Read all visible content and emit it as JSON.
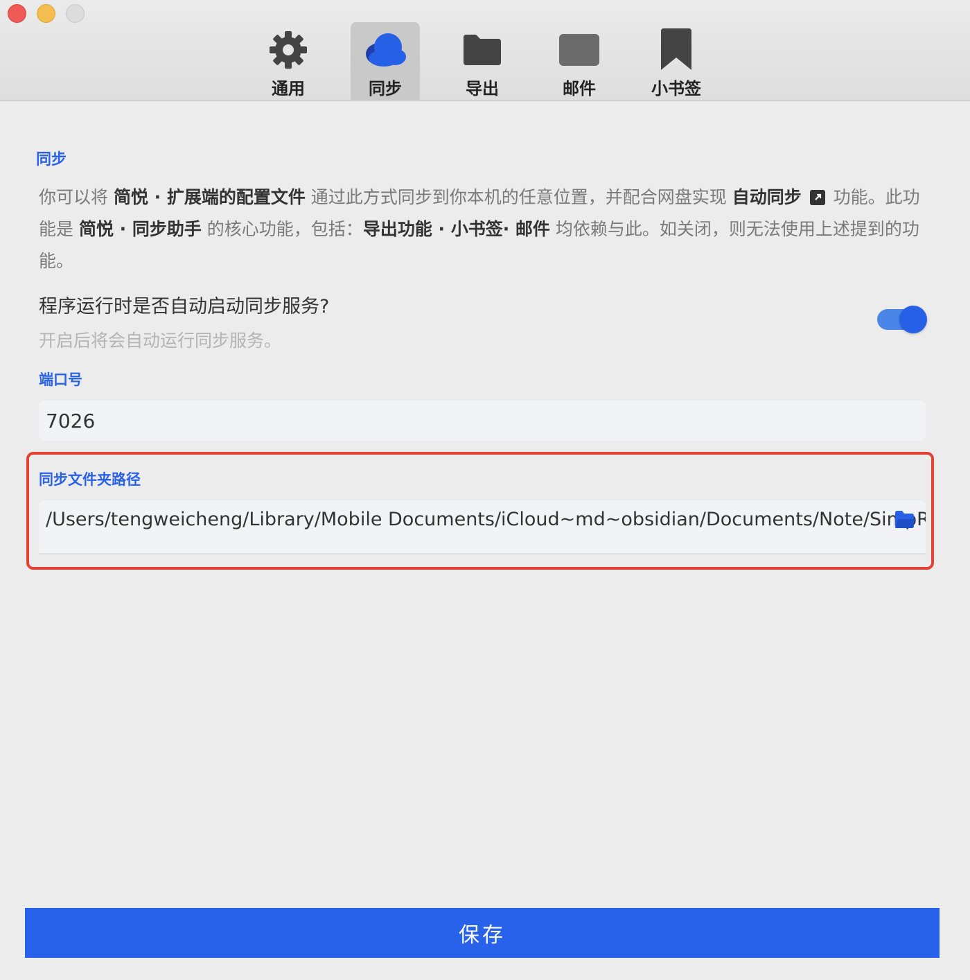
{
  "window": {
    "traffic_lights": [
      "close",
      "minimize",
      "maximize"
    ]
  },
  "tabs": [
    {
      "label": "通用",
      "icon": "gear-icon",
      "active": false
    },
    {
      "label": "同步",
      "icon": "cloud-icon",
      "active": true
    },
    {
      "label": "导出",
      "icon": "folder-icon",
      "active": false
    },
    {
      "label": "邮件",
      "icon": "mail-icon",
      "active": false
    },
    {
      "label": "小书签",
      "icon": "bookmark-icon",
      "active": false
    }
  ],
  "sync": {
    "section_title": "同步",
    "desc_p1": "你可以将 ",
    "desc_b1": "简悦 · 扩展端的配置文件",
    "desc_p2": " 通过此方式同步到你本机的任意位置，并配合网盘实现 ",
    "desc_b2": "自动同步",
    "desc_p3": " 功能。此功能是 ",
    "desc_b3": "简悦 · 同步助手",
    "desc_p4": " 的核心功能，包括：",
    "desc_b4": "导出功能 · 小书签· 邮件",
    "desc_p5": " 均依赖与此。如关闭，则无法使用上述提到的功能。",
    "autostart_question": "程序运行时是否自动启动同步服务?",
    "autostart_hint": "开启后将会自动运行同步服务。",
    "autostart_enabled": true,
    "port_label": "端口号",
    "port_value": "7026",
    "path_label": "同步文件夹路径",
    "path_value": "/Users/tengweicheng/Library/Mobile Documents/iCloud~md~obsidian/Documents/Note/SimpRead"
  },
  "footer": {
    "save_label": "保存"
  },
  "colors": {
    "accent": "#2962e8",
    "highlight": "#e34234",
    "toggle_on": "#2660e6"
  }
}
